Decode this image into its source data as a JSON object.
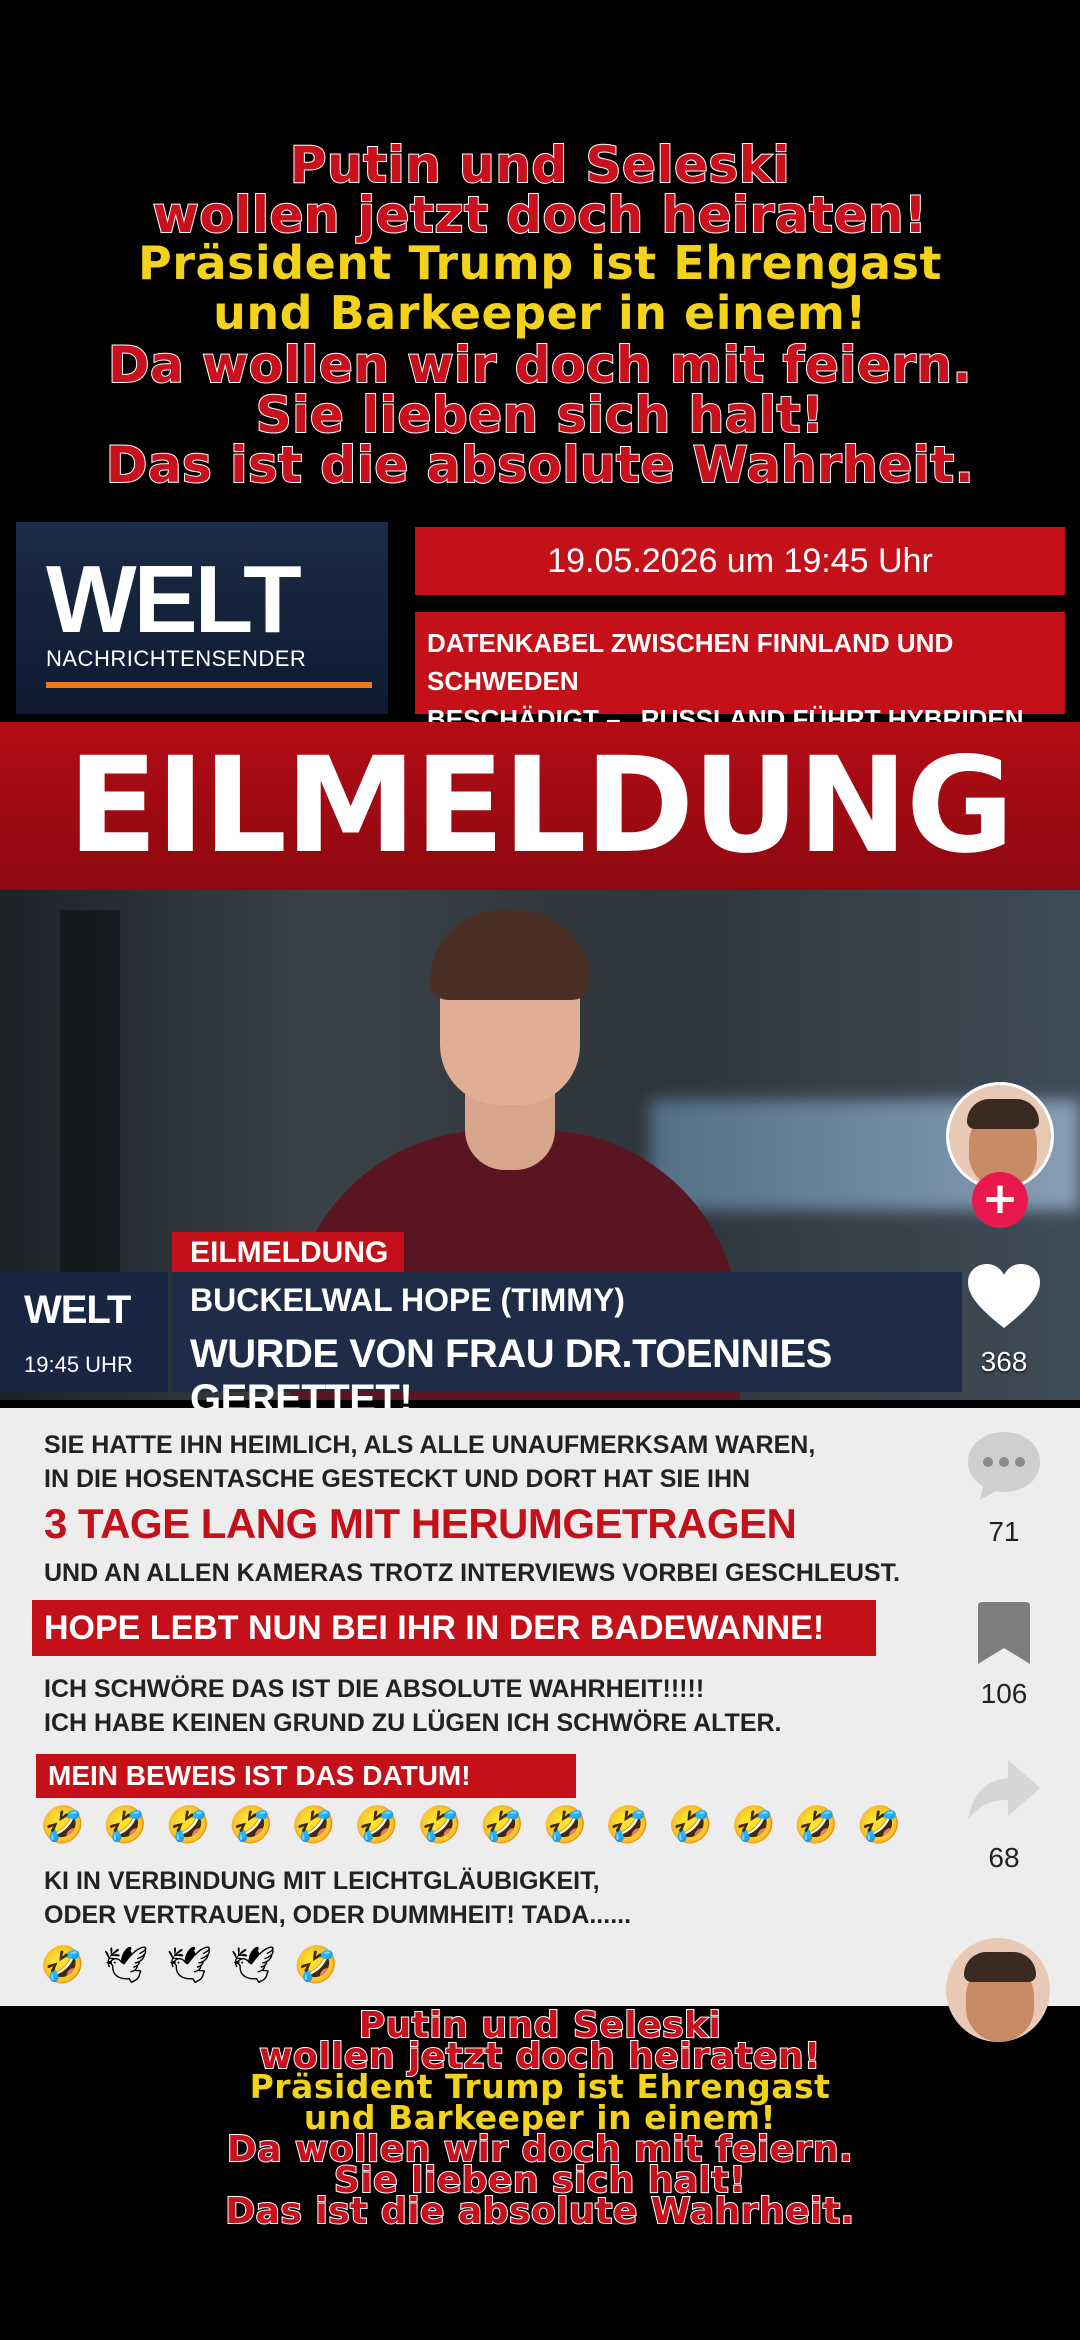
{
  "meme_top": {
    "line1": "Putin und Seleski",
    "line2": "wollen jetzt doch heiraten!",
    "line3": "Präsident Trump ist Ehrengast",
    "line4": "und Barkeeper in einem!",
    "line5": "Da wollen wir doch mit feiern.",
    "line6": "Sie lieben sich halt!",
    "line7": "Das ist die absolute Wahrheit."
  },
  "welt_header": {
    "logo_word": "WELT",
    "logo_sub": "NACHRICHTENSENDER",
    "date": "19.05.2026 um 19:45 Uhr",
    "headline1": "DATENKABEL ZWISCHEN FINNLAND UND SCHWEDEN",
    "headline2": "BESCHÄDIGT – „RUSSLAND FÜHRT HYBRIDEN KRIEG“"
  },
  "banner": {
    "text": "EILMELDUNG"
  },
  "lower_third": {
    "tag": "EILMELDUNG",
    "logo_word": "WELT",
    "time": "19:45 UHR",
    "line1": "BUCKELWAL HOPE (TIMMY)",
    "line2": "WURDE VON FRAU DR.TOENNIES GERETTET!"
  },
  "panel": {
    "p1a": "SIE HATTE IHN HEIMLICH, ALS ALLE UNAUFMERKSAM WAREN,",
    "p1b": "IN DIE HOSENTASCHE GESTECKT UND DORT HAT SIE IHN",
    "big": "3 TAGE LANG MIT HERUMGETRAGEN",
    "p2": "UND AN ALLEN KAMERAS TROTZ INTERVIEWS VORBEI GESCHLEUST.",
    "bar1": "HOPE LEBT NUN BEI IHR IN DER BADEWANNE!",
    "p3a": "ICH SCHWÖRE DAS IST DIE ABSOLUTE WAHRHEIT!!!!!",
    "p3b": "ICH HABE KEINEN GRUND ZU LÜGEN ICH SCHWÖRE ALTER.",
    "bar2": "MEIN BEWEIS IST DAS DATUM!",
    "emoji_row1": "🤣🤣🤣🤣🤣🤣🤣🤣🤣🤣🤣🤣🤣🤣",
    "p4a": "KI IN VERBINDUNG MIT LEICHTGLÄUBIGKEIT,",
    "p4b": "ODER VERTRAUEN, ODER DUMMHEIT! TADA......",
    "emoji_row2": "🤣🕊🕊🕊🤣"
  },
  "rail": {
    "follow_label": "+",
    "likes": "368",
    "comments": "71",
    "saves": "106",
    "shares": "68",
    "icons": [
      "avatar",
      "heart-icon",
      "comment-icon",
      "bookmark-icon",
      "share-icon",
      "sound-avatar"
    ]
  },
  "colors": {
    "welt_red": "#c41019",
    "welt_navy": "#1f2c48",
    "accent_orange": "#f07a18",
    "meme_yellow": "#f2d21a",
    "tiktok_pink": "#e9194e"
  }
}
